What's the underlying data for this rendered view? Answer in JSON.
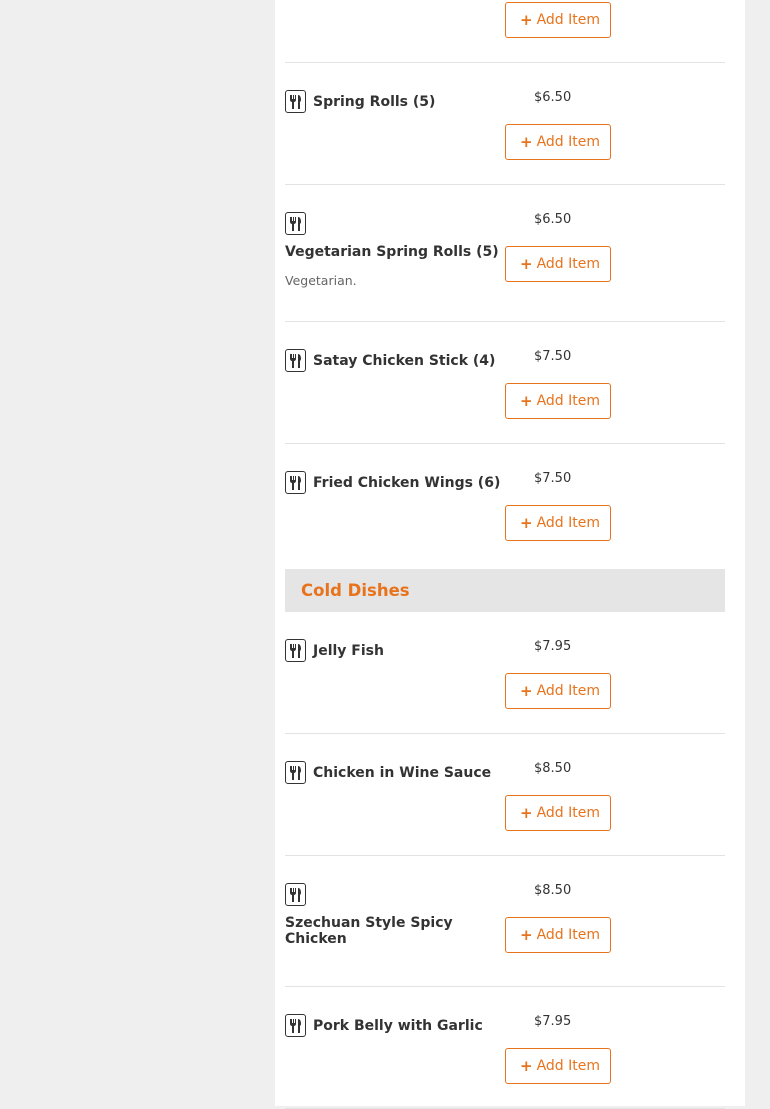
{
  "colors": {
    "accent": "#e8731d",
    "panel_bg": "#ffffff",
    "page_bg": "#efefef",
    "divider": "#e3e3e3"
  },
  "add_label": "Add Item",
  "sections": [
    {
      "header": "",
      "items": [
        {
          "name": "",
          "price": "",
          "desc": ""
        },
        {
          "name": "Spring Rolls (5)",
          "price": "$6.50",
          "desc": ""
        },
        {
          "name": "Vegetarian Spring Rolls (5)",
          "price": "$6.50",
          "desc": "Vegetarian."
        },
        {
          "name": "Satay Chicken Stick (4)",
          "price": "$7.50",
          "desc": ""
        },
        {
          "name": "Fried Chicken Wings (6)",
          "price": "$7.50",
          "desc": ""
        }
      ]
    },
    {
      "header": "Cold Dishes",
      "items": [
        {
          "name": "Jelly Fish",
          "price": "$7.95",
          "desc": ""
        },
        {
          "name": "Chicken in Wine Sauce",
          "price": "$8.50",
          "desc": ""
        },
        {
          "name": "Szechuan Style Spicy Chicken",
          "price": "$8.50",
          "desc": ""
        },
        {
          "name": "Pork Belly with Garlic",
          "price": "$7.95",
          "desc": ""
        }
      ]
    }
  ]
}
